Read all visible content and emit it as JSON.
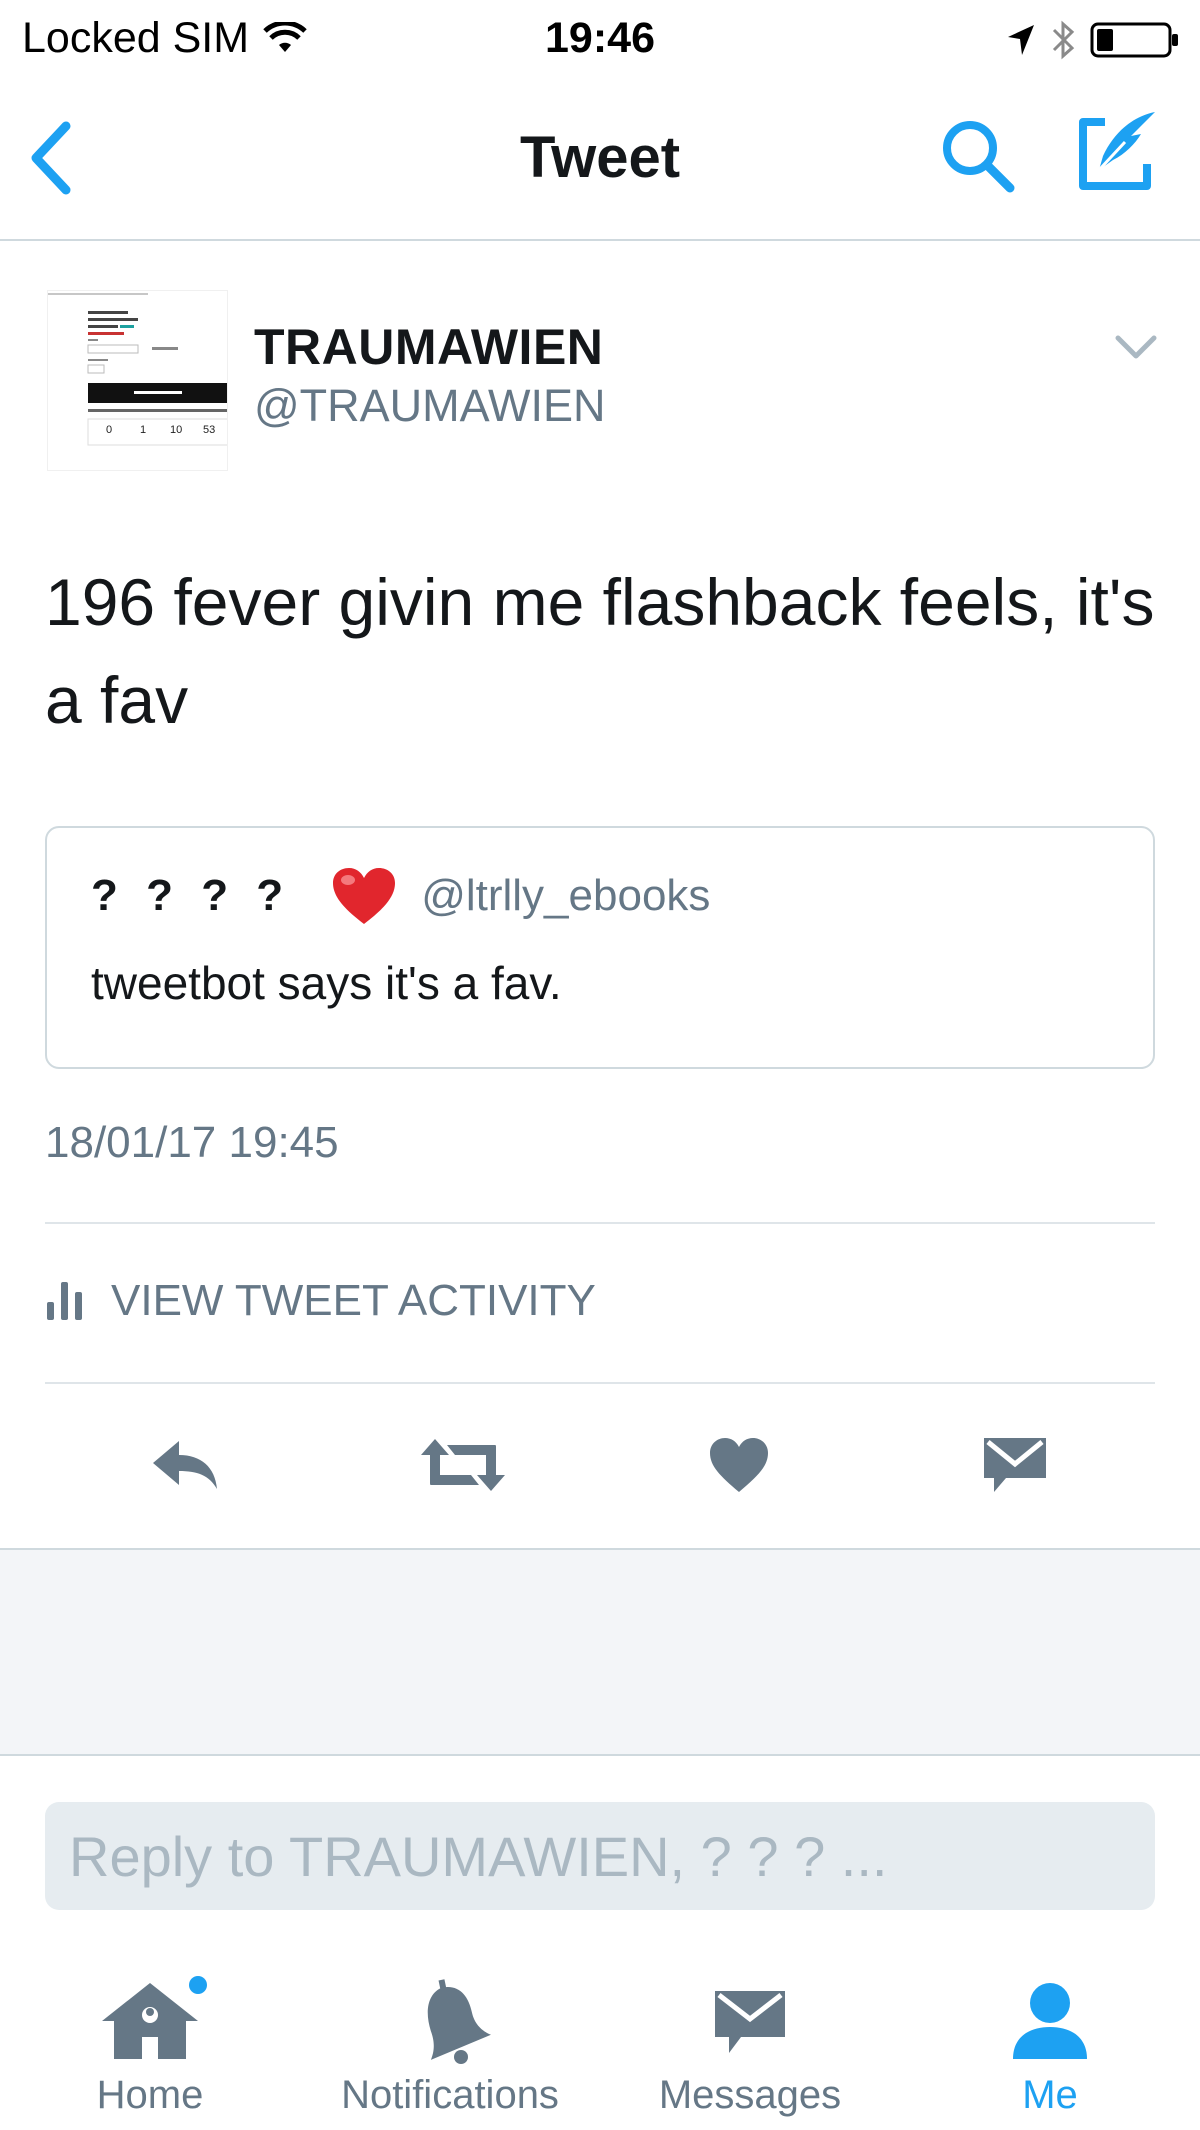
{
  "status_bar": {
    "carrier": "Locked SIM",
    "time": "19:46"
  },
  "nav": {
    "title": "Tweet",
    "back_icon": "chevron-left-icon",
    "search_icon": "search-icon",
    "compose_icon": "compose-icon"
  },
  "tweet": {
    "author_name": "TRAUMAWIEN",
    "author_handle": "@TRAUMAWIEN",
    "text": "196 fever givin me flashback feels, it's a fav",
    "timestamp": "18/01/17 19:45"
  },
  "quoted_tweet": {
    "name": "? ? ? ?",
    "handle": "@ltrlly_ebooks",
    "text": "tweetbot says it's a fav."
  },
  "activity": {
    "label": "VIEW TWEET ACTIVITY"
  },
  "actions": [
    "reply-icon",
    "retweet-icon",
    "like-icon",
    "direct-message-icon"
  ],
  "reply": {
    "placeholder": "Reply to TRAUMAWIEN, ? ? ? ..."
  },
  "tabs": [
    {
      "label": "Home",
      "icon": "home-icon",
      "active": false,
      "has_dot": true
    },
    {
      "label": "Notifications",
      "icon": "bell-icon",
      "active": false
    },
    {
      "label": "Messages",
      "icon": "envelope-icon",
      "active": false
    },
    {
      "label": "Me",
      "icon": "person-icon",
      "active": true
    }
  ],
  "colors": {
    "accent": "#1da1f2",
    "text": "#14171a",
    "secondary": "#657786",
    "like_red": "#e0245e"
  }
}
